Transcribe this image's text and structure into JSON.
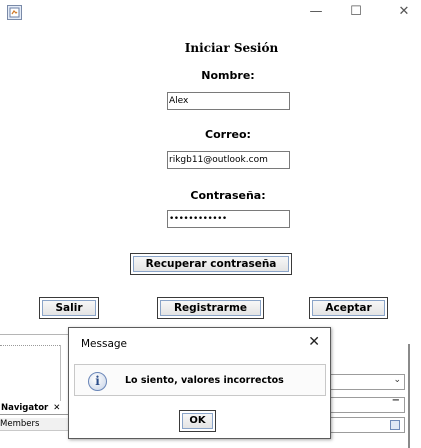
{
  "window": {
    "icon": "java-app-icon",
    "minimize_glyph": "—",
    "maximize_glyph": "☐",
    "close_glyph": "✕"
  },
  "form": {
    "title": "Iniciar Sesión",
    "nombre_label": "Nombre:",
    "nombre_value": "Alex",
    "correo_label": "Correo:",
    "correo_value": "rikgb11@outlook.com",
    "password_label": "Contraseña:",
    "password_value": "••••••••••••"
  },
  "buttons": {
    "recuperar": "Recuperar contraseña",
    "salir": "Salir",
    "registrarme": "Registrarme",
    "aceptar": "Aceptar"
  },
  "background": {
    "navigator_label": "Navigator",
    "navigator_close": "✕",
    "members_label": "Members",
    "combo_chevron": "⌄",
    "minus_glyph": "−"
  },
  "dialog": {
    "title": "Message",
    "close_glyph": "✕",
    "icon": "info-icon",
    "icon_glyph": "i",
    "message": "Lo siento, valores incorrectos",
    "ok_label": "OK"
  }
}
